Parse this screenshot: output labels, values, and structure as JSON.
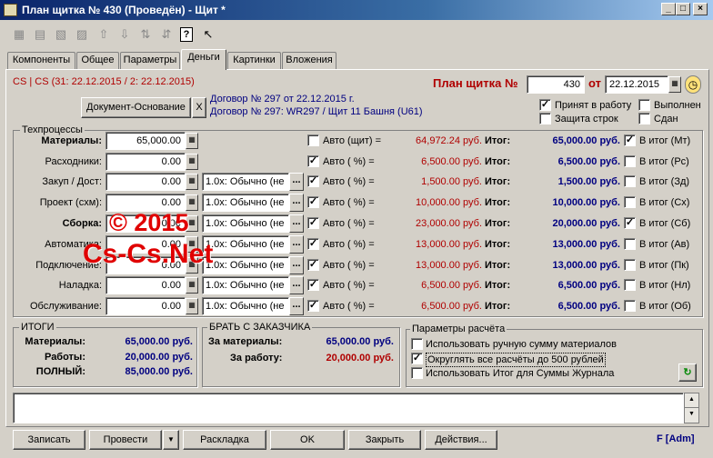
{
  "window": {
    "title": "План щитка № 430 (Проведён) - Щит *"
  },
  "tabs": [
    "Компоненты",
    "Общее",
    "Параметры",
    "Деньги",
    "Картинки",
    "Вложения"
  ],
  "header": {
    "cs_link": "CS | CS (31: 22.12.2015 / 2: 22.12.2015)",
    "plan_label": "План щитка №",
    "plan_number": "430",
    "from_label": "от",
    "date": "22.12.2015",
    "doc_base_button": "Документ-Основание",
    "x_button": "X",
    "contract_line1": "Договор № 297 от 22.12.2015 г.",
    "contract_line2": "Договор № 297: WR297 / Щит 11 Башня (U61)",
    "flags": [
      {
        "label": "Принят в работу",
        "checked": true
      },
      {
        "label": "Выполнен",
        "checked": false
      },
      {
        "label": "Защита строк",
        "checked": false
      },
      {
        "label": "Сдан",
        "checked": false
      }
    ]
  },
  "processes": {
    "title": "Техпроцессы",
    "total_label": "Итог:",
    "in_total_label": "В итог",
    "rows": [
      {
        "label": "Материалы:",
        "value": "65,000.00",
        "combo": "",
        "auto_checked": false,
        "auto_label": "Авто (щит) =",
        "auto_value": "64,972.24 руб.",
        "total": "65,000.00 руб.",
        "in_total_checked": true,
        "code": "(Мт)",
        "bold": true
      },
      {
        "label": "Расходники:",
        "value": "0.00",
        "combo": "",
        "auto_checked": true,
        "auto_label": "Авто (    %) =",
        "auto_value": "6,500.00 руб.",
        "total": "6,500.00 руб.",
        "in_total_checked": false,
        "code": "(Рс)",
        "bold": false
      },
      {
        "label": "Закуп / Дост:",
        "value": "0.00",
        "combo": "1.0x: Обычно (не",
        "auto_checked": true,
        "auto_label": "Авто (    %) =",
        "auto_value": "1,500.00 руб.",
        "total": "1,500.00 руб.",
        "in_total_checked": false,
        "code": "(Зд)",
        "bold": false
      },
      {
        "label": "Проект (схм):",
        "value": "0.00",
        "combo": "1.0x: Обычно (не",
        "auto_checked": true,
        "auto_label": "Авто (    %) =",
        "auto_value": "10,000.00 руб.",
        "total": "10,000.00 руб.",
        "in_total_checked": false,
        "code": "(Сх)",
        "bold": false
      },
      {
        "label": "Сборка:",
        "value": "0.00",
        "combo": "1.0x: Обычно (не",
        "auto_checked": true,
        "auto_label": "Авто (    %) =",
        "auto_value": "23,000.00 руб.",
        "total": "20,000.00 руб.",
        "in_total_checked": true,
        "code": "(Сб)",
        "bold": true
      },
      {
        "label": "Автоматика:",
        "value": "0.00",
        "combo": "1.0x: Обычно (не",
        "auto_checked": true,
        "auto_label": "Авто (    %) =",
        "auto_value": "13,000.00 руб.",
        "total": "13,000.00 руб.",
        "in_total_checked": false,
        "code": "(Ав)",
        "bold": false
      },
      {
        "label": "Подключение:",
        "value": "0.00",
        "combo": "1.0x: Обычно (не",
        "auto_checked": true,
        "auto_label": "Авто (    %) =",
        "auto_value": "13,000.00 руб.",
        "total": "13,000.00 руб.",
        "in_total_checked": false,
        "code": "(Пк)",
        "bold": false
      },
      {
        "label": "Наладка:",
        "value": "0.00",
        "combo": "1.0x: Обычно (не",
        "auto_checked": true,
        "auto_label": "Авто (    %) =",
        "auto_value": "6,500.00 руб.",
        "total": "6,500.00 руб.",
        "in_total_checked": false,
        "code": "(Нл)",
        "bold": false
      },
      {
        "label": "Обслуживание:",
        "value": "0.00",
        "combo": "1.0x: Обычно (не",
        "auto_checked": true,
        "auto_label": "Авто (    %) =",
        "auto_value": "6,500.00 руб.",
        "total": "6,500.00 руб.",
        "in_total_checked": false,
        "code": "(Об)",
        "bold": false
      }
    ]
  },
  "totals": {
    "title": "ИТОГИ",
    "rows": [
      {
        "label": "Материалы:",
        "value": "65,000.00 руб."
      },
      {
        "label": "Работы:",
        "value": "20,000.00 руб."
      },
      {
        "label": "ПОЛНЫЙ:",
        "value": "85,000.00 руб."
      }
    ]
  },
  "customer": {
    "title": "БРАТЬ С ЗАКАЗЧИКА",
    "rows": [
      {
        "label": "За материалы:",
        "value": "65,000.00 руб.",
        "color": "#000080"
      },
      {
        "label": "За работу:",
        "value": "20,000.00 руб.",
        "color": "#b00000"
      }
    ]
  },
  "params": {
    "title": "Параметры расчёта",
    "options": [
      {
        "label": "Использовать ручную сумму материалов",
        "checked": false
      },
      {
        "label": "Округлять все расчёты до 500 рублей",
        "checked": true
      },
      {
        "label": "Использовать Итог для Суммы Журнала",
        "checked": false
      }
    ]
  },
  "watermark": {
    "line1": "© 2015",
    "line2": "Cs-Cs.Net"
  },
  "buttons": {
    "save": "Записать",
    "post": "Провести",
    "layout": "Раскладка",
    "ok": "OK",
    "close": "Закрыть",
    "actions": "Действия..."
  },
  "status": "F [Adm]"
}
